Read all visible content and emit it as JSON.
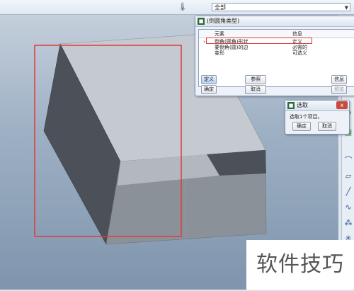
{
  "toolbar": {
    "icon": "thermometer-icon",
    "filter_value": "全部"
  },
  "collector_dialog": {
    "title": "(倒圆角类型)",
    "close_label": "x",
    "headers": {
      "element": "元素",
      "info": "信息"
    },
    "rows": [
      {
        "element": "倒角(圆角)形状",
        "info": "定义"
      },
      {
        "element": "要倒角(圆)的边",
        "info": "必需的"
      },
      {
        "element": "变形",
        "info": "可选义"
      }
    ],
    "buttons": {
      "define": "定义",
      "reference": "参照",
      "info": "信息",
      "confirm": "确定",
      "cancel": "取消",
      "preview": "预览"
    }
  },
  "select_dialog": {
    "title": "选取",
    "message": "选取1个项目。",
    "buttons": {
      "confirm": "确定",
      "cancel": "取消"
    }
  },
  "selection_box_color": "#e03a3a",
  "watermark": "软件技巧"
}
